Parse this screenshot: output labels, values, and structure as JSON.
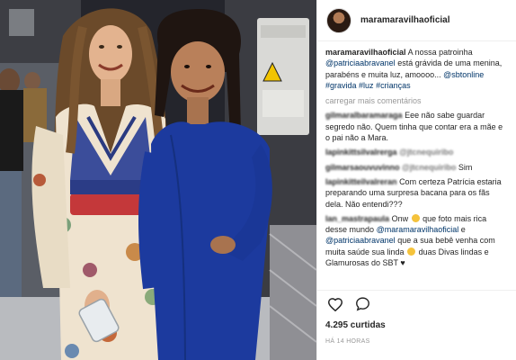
{
  "post": {
    "author": "maramaravilhaoficial",
    "caption": {
      "username": "maramaravilhaoficial",
      "text_1": "A nossa patroinha",
      "mention_1": "@patriciaabravanel",
      "text_2": "está grávida de uma menina, parabéns e muita luz, amoooo...",
      "mention_2": "@sbtonline",
      "hashtag_1": "#gravida",
      "hashtag_2": "#luz",
      "hashtag_3": "#crianças"
    },
    "load_more": "carregar mais comentários",
    "comments": [
      {
        "username": "gilmaralbaramaraga",
        "text": "Eee não sabe guardar segredo não. Quem tinha que contar era a mãe e o pai não a Mara."
      },
      {
        "username": "lapinkittsilvalrerga",
        "text": "@jtcnequiribo",
        "mention_only": true
      },
      {
        "username": "gilmarsaouvuvinno",
        "mention": "@jtcnequiribo",
        "text": "Sim"
      },
      {
        "username": "lapinkitteilvalreran",
        "text": "Com certeza Patrícia estaria preparando uma surpresa bacana para os fãs dela. Não entendi???"
      },
      {
        "username": "lan_mastrapaula",
        "text_1": "Onw",
        "text_2": "que foto mais rica desse mundo",
        "mention_1": "@maramaravilhaoficial",
        "text_3": "e",
        "mention_2": "@patriciaabravanel",
        "text_4": "que a sua bebê venha com muita saúde sua linda",
        "text_5": "duas Divas lindas e Glamurosas do SBT"
      }
    ],
    "likes": "4.295 curtidas",
    "time": "HÁ 14 HORAS",
    "icons": {
      "like": "heart-icon",
      "comment": "comment-bubble-icon"
    },
    "colors": {
      "accent_link": "#003569",
      "muted": "#999999",
      "blue_dress": "#1c3a9e"
    }
  }
}
